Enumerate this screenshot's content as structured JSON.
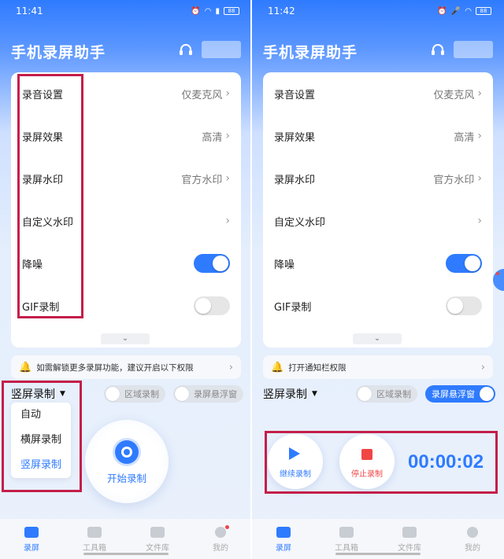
{
  "left": {
    "status_time": "11:41",
    "battery": "88",
    "app_title": "手机录屏助手",
    "settings": [
      {
        "label": "录音设置",
        "value": "仅麦克风"
      },
      {
        "label": "录屏效果",
        "value": "高清"
      },
      {
        "label": "录屏水印",
        "value": "官方水印"
      },
      {
        "label": "自定义水印",
        "value": ""
      }
    ],
    "noise_label": "降噪",
    "noise_on": true,
    "gif_label": "GIF录制",
    "gif_on": false,
    "tip_text": "如需解锁更多录屏功能，建议开启以下权限",
    "mode_selected": "竖屏录制",
    "region_pill": "区域录制",
    "float_pill": "录屏悬浮窗",
    "dropdown_options": [
      "自动",
      "横屏录制",
      "竖屏录制"
    ],
    "start_label": "开始录制",
    "tabs": [
      "录屏",
      "工具箱",
      "文件库",
      "我的"
    ]
  },
  "right": {
    "status_time": "11:42",
    "battery": "88",
    "app_title": "手机录屏助手",
    "settings": [
      {
        "label": "录音设置",
        "value": "仅麦克风"
      },
      {
        "label": "录屏效果",
        "value": "高清"
      },
      {
        "label": "录屏水印",
        "value": "官方水印"
      },
      {
        "label": "自定义水印",
        "value": ""
      }
    ],
    "noise_label": "降噪",
    "noise_on": true,
    "gif_label": "GIF录制",
    "gif_on": false,
    "tip_text": "打开通知栏权限",
    "mode_selected": "竖屏录制",
    "region_pill": "区域录制",
    "float_pill": "录屏悬浮窗",
    "float_on": true,
    "continue_label": "继续录制",
    "stop_label": "停止录制",
    "timer": "00:00:02",
    "tabs": [
      "录屏",
      "工具箱",
      "文件库",
      "我的"
    ]
  },
  "colors": {
    "accent": "#2f7bff",
    "highlight": "#c41e4a",
    "stop": "#f04545"
  }
}
